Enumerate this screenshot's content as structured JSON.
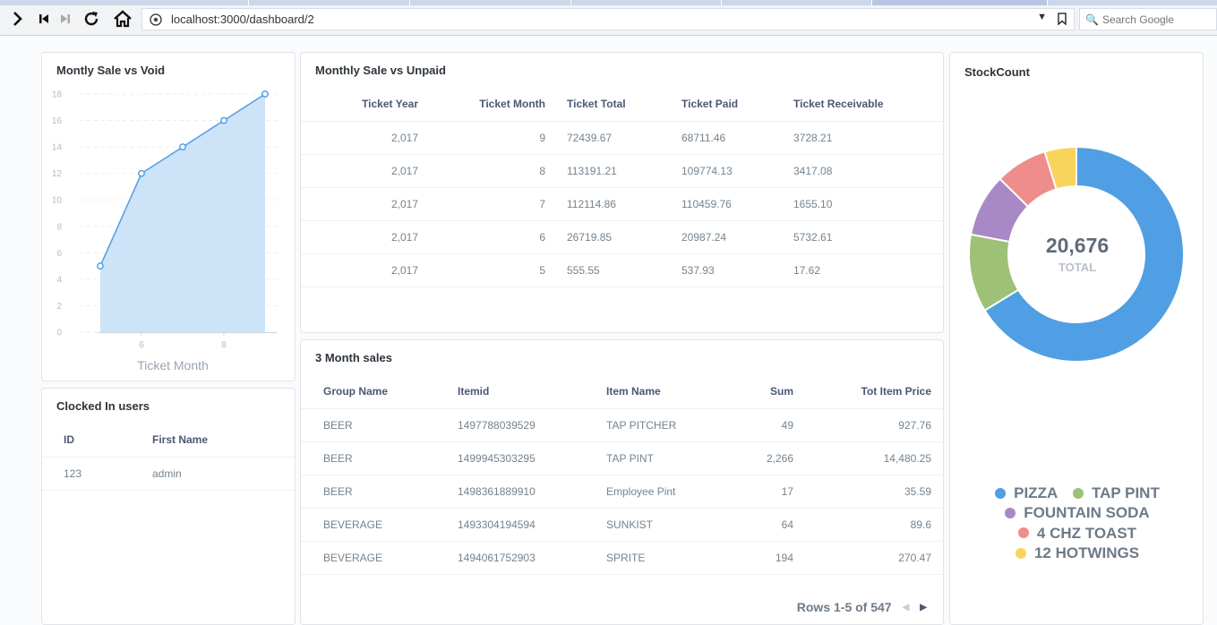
{
  "browser": {
    "url": "localhost:3000/dashboard/2",
    "search_placeholder": "Search Google"
  },
  "colors": {
    "accent_blue": "#509ee3",
    "area_fill": "#cde3f8",
    "green": "#9cc177",
    "purple": "#a989c5",
    "red": "#ef8c8c",
    "yellow": "#f9d45c"
  },
  "sale_vs_void": {
    "title": "Montly Sale vs Void",
    "chart_data": {
      "type": "area",
      "x": [
        5,
        6,
        7,
        8,
        9
      ],
      "y": [
        5,
        12,
        14,
        16,
        18
      ],
      "xlabel": "Ticket Month",
      "ylabel": "",
      "xlim": [
        4.5,
        9.5
      ],
      "ylim": [
        0,
        18
      ],
      "y_ticks": [
        0,
        2,
        4,
        6,
        8,
        10,
        12,
        14,
        16,
        18
      ],
      "x_ticks": [
        6,
        8
      ],
      "grid": true
    }
  },
  "sale_vs_unpaid": {
    "title": "Monthly Sale vs Unpaid",
    "columns": [
      "Ticket Year",
      "Ticket Month",
      "Ticket Total",
      "Ticket Paid",
      "Ticket Receivable"
    ],
    "rows": [
      [
        "2,017",
        "9",
        "72439.67",
        "68711.46",
        "3728.21"
      ],
      [
        "2,017",
        "8",
        "113191.21",
        "109774.13",
        "3417.08"
      ],
      [
        "2,017",
        "7",
        "112114.86",
        "110459.76",
        "1655.10"
      ],
      [
        "2,017",
        "6",
        "26719.85",
        "20987.24",
        "5732.61"
      ],
      [
        "2,017",
        "5",
        "555.55",
        "537.93",
        "17.62"
      ]
    ]
  },
  "stock_count": {
    "title": "StockCount",
    "total_value": "20,676",
    "total_label": "TOTAL",
    "chart_data": {
      "type": "pie",
      "categories": [
        "PIZZA",
        "TAP PINT",
        "FOUNTAIN SODA",
        "4 CHZ TOAST",
        "12 HOTWINGS"
      ],
      "values": [
        13700,
        2420,
        1950,
        1620,
        986
      ],
      "colors": [
        "#509ee3",
        "#9cc177",
        "#a989c5",
        "#ef8c8c",
        "#f9d45c"
      ]
    }
  },
  "clocked_in": {
    "title": "Clocked In users",
    "columns": [
      "ID",
      "First Name"
    ],
    "rows": [
      [
        "123",
        "admin"
      ]
    ]
  },
  "three_month_sales": {
    "title": "3 Month sales",
    "columns": [
      "Group Name",
      "Itemid",
      "Item Name",
      "Sum",
      "Tot Item Price"
    ],
    "rows": [
      [
        "BEER",
        "1497788039529",
        "TAP PITCHER",
        "49",
        "927.76"
      ],
      [
        "BEER",
        "1499945303295",
        "TAP PINT",
        "2,266",
        "14,480.25"
      ],
      [
        "BEER",
        "1498361889910",
        "Employee Pint",
        "17",
        "35.59"
      ],
      [
        "BEVERAGE",
        "1493304194594",
        "SUNKIST",
        "64",
        "89.6"
      ],
      [
        "BEVERAGE",
        "1494061752903",
        "SPRITE",
        "194",
        "270.47"
      ]
    ],
    "pagination": "Rows 1-5 of 547"
  }
}
